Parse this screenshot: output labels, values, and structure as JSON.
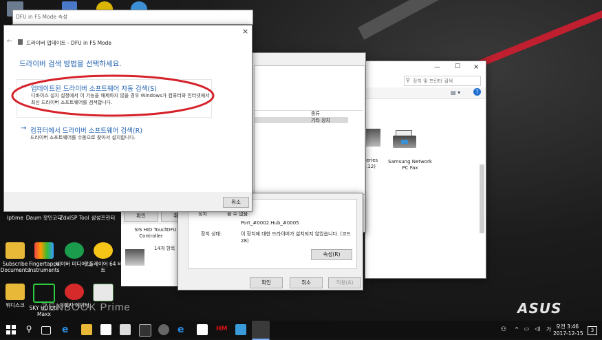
{
  "desktop": {
    "icons": [
      {
        "label": "Iptime"
      },
      {
        "label": "Daum 팟인코더"
      },
      {
        "label": "ZdxISP Tool"
      },
      {
        "label": "삼성프린터"
      },
      {
        "label": "Subscribe Documents"
      },
      {
        "label": "Fingertapps Instruments"
      },
      {
        "label": "네이버 미디어 ..."
      },
      {
        "label": "팟플레이어 64 비트"
      },
      {
        "label": "위디스크"
      },
      {
        "label": "SKY HD Util Maxx"
      },
      {
        "label": "이미지 에디터"
      }
    ],
    "brand": "ASUS",
    "watermark": "ZENBOOK Prime"
  },
  "props_title": "DFU in FS Mode 속성",
  "wizard": {
    "title": "드라이버 업데이트 - DFU in FS Mode",
    "heading": "드라이버 검색 방법을 선택하세요.",
    "option1_title": "업데이트된 드라이버 소프트웨어 자동 검색(S)",
    "option1_desc": "디바이스 설치 설정에서 이 기능을 해제하지 않을 경우 Windows가 컴퓨터와 인터넷에서 최신 드라이버 소프트웨어를 검색합니다.",
    "option2_title": "컴퓨터에서 드라이버 소프트웨어 검색(R)",
    "option2_desc": "드라이버 소프트웨어를 수동으로 찾아서 설치합니다.",
    "cancel": "취소",
    "close": "×",
    "back": "←"
  },
  "devmgr": {
    "col_type": "종류",
    "row_type": "기타 장치",
    "ok": "확인",
    "cancel": "취소"
  },
  "explorer": {
    "search_placeholder": "장치 및 프린터 검색",
    "printer_name": "Samsung Network PC Fax",
    "partial_label": "0 Series 8.0.12)",
    "sis_label": "SIS HID Touch Controller",
    "dfu_label": "DFU",
    "count": "14개 항목"
  },
  "props": {
    "loc_value": "Port_#0002.Hub_#0005",
    "status_label": "장치 상태:",
    "status_value": "이 장치에 대한 드라이버가 설치되지 않았습니다. (코드 28)",
    "reinstall": "속성(R)",
    "ok": "확인",
    "cancel": "취소",
    "apply": "적용(A)",
    "partial_top": "정치",
    "partial_label": "음 수 없음"
  },
  "taskbar": {
    "time": "오전 3:46",
    "date": "2017-12-15",
    "notify": "3",
    "ime": "가"
  },
  "colors": {
    "link": "#1e5fb0",
    "annotation": "#d6222b",
    "hm": "#d11"
  }
}
